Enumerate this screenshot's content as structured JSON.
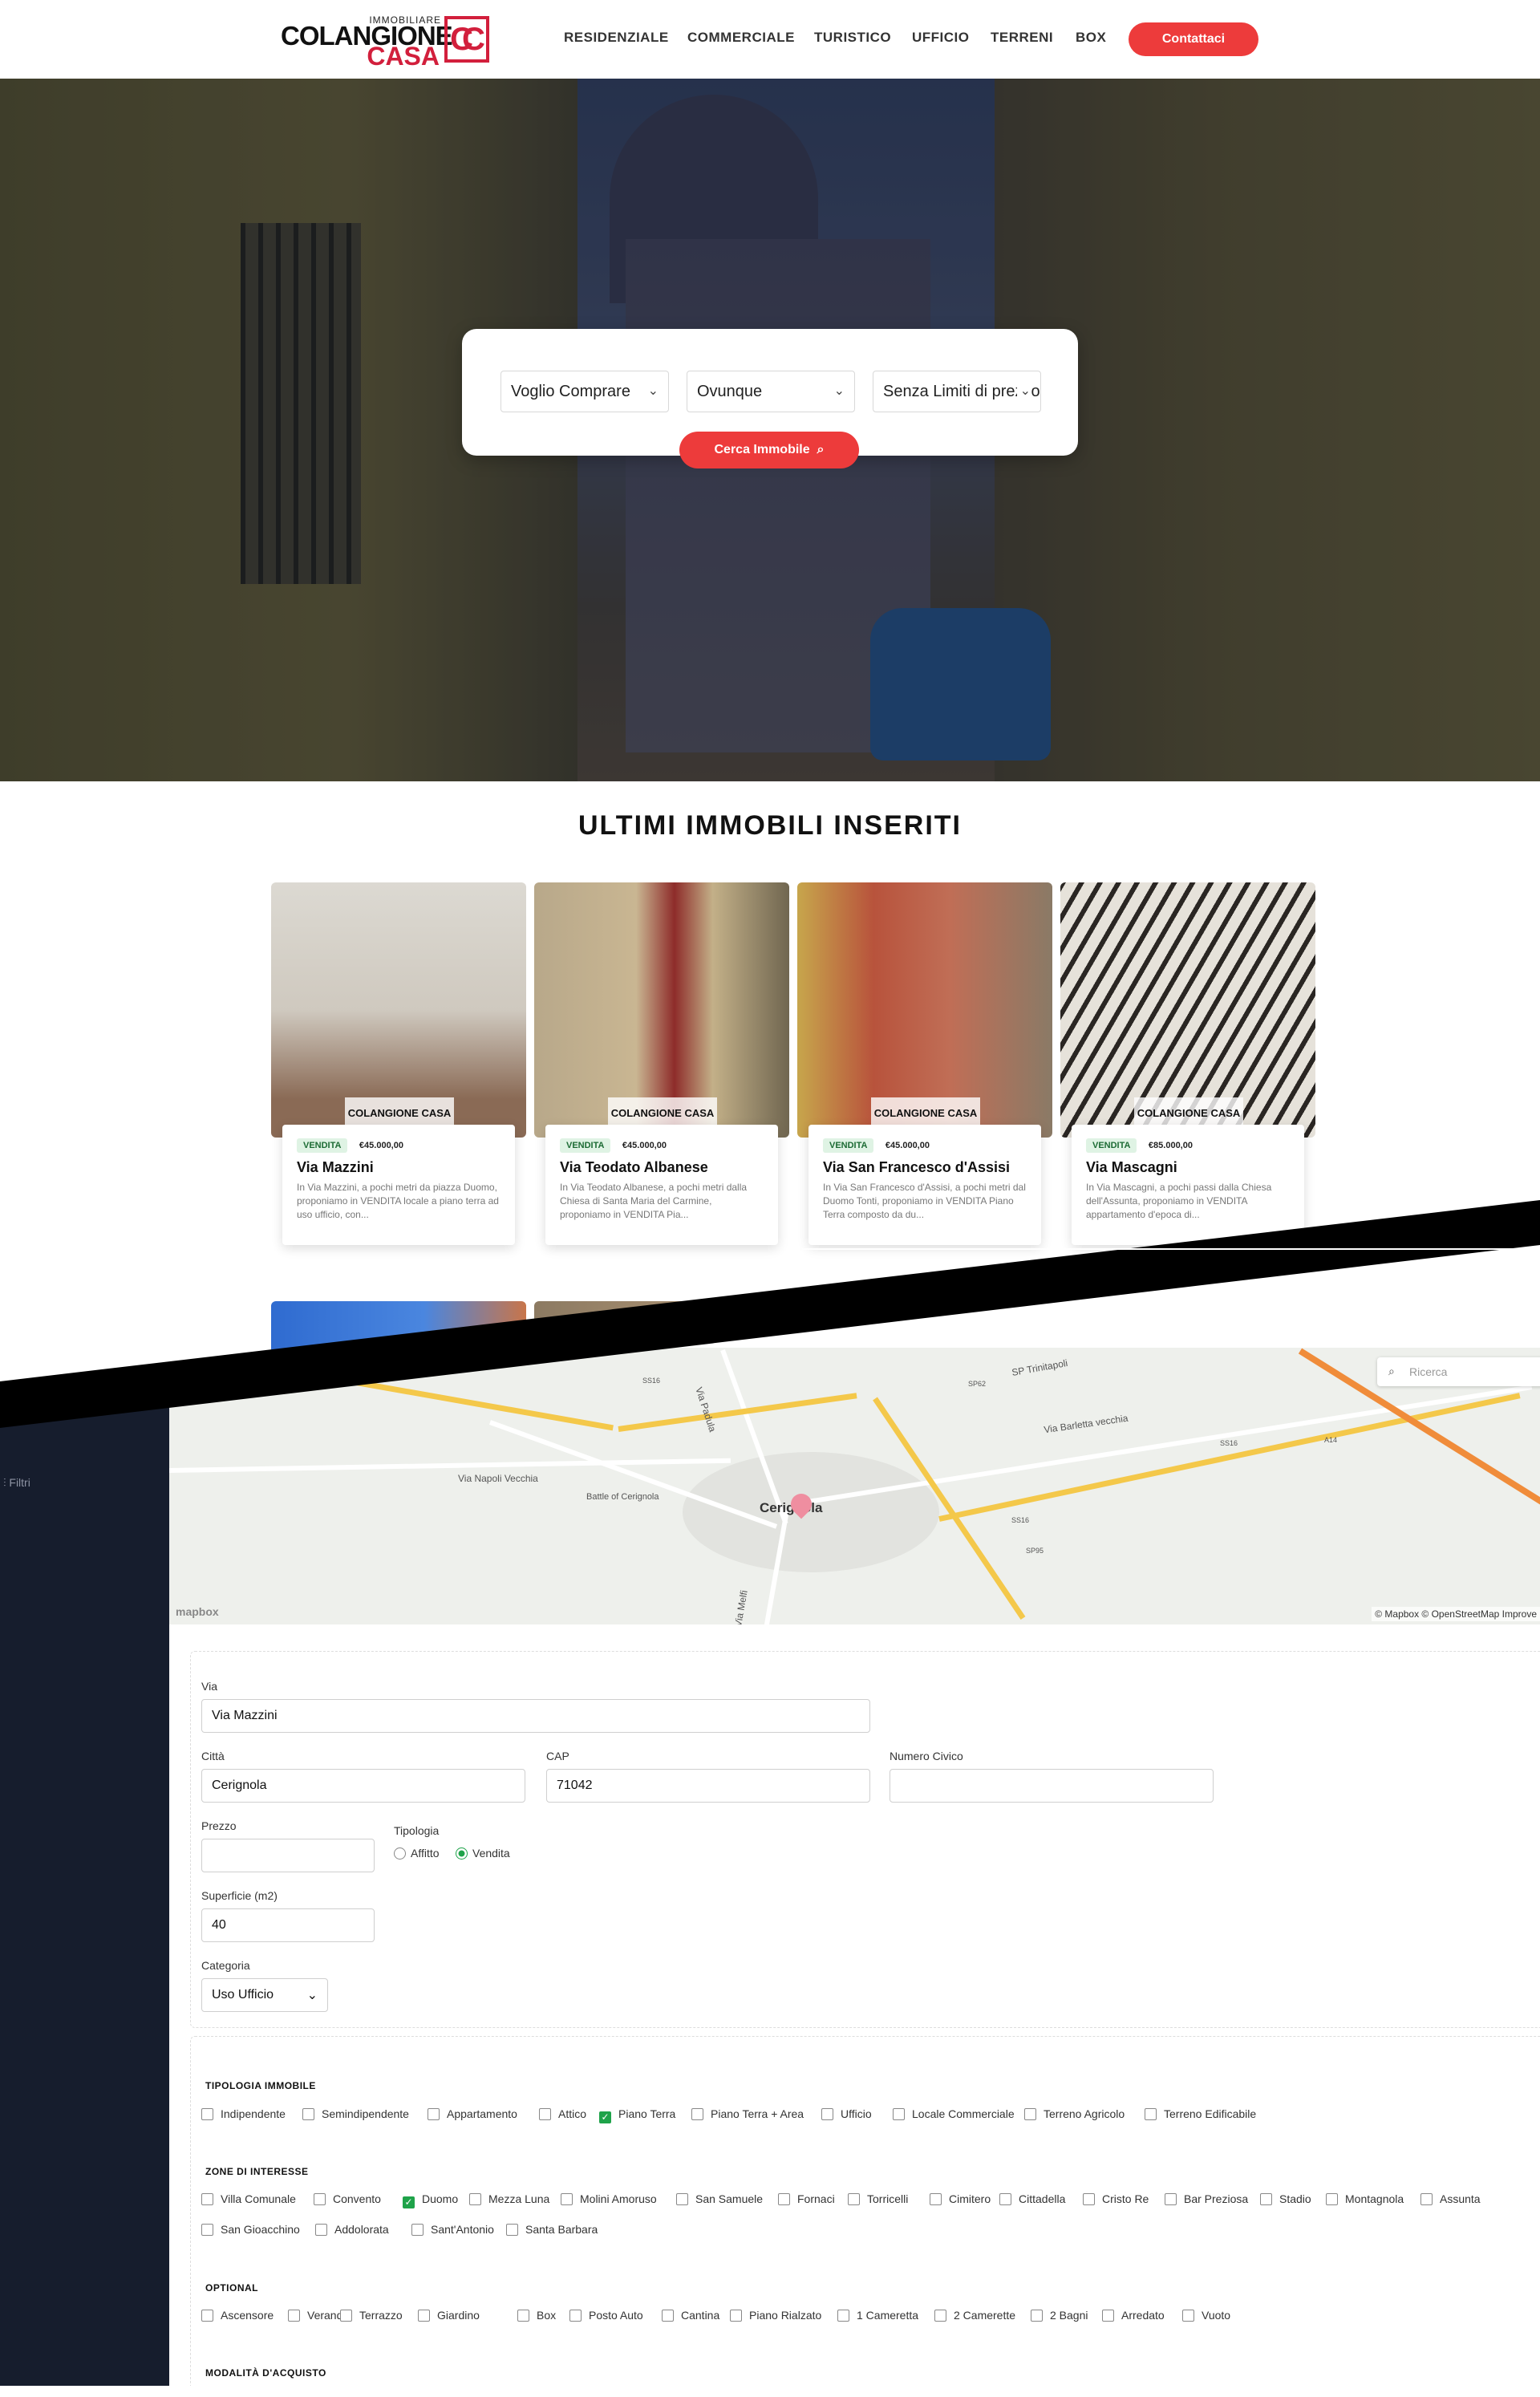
{
  "header": {
    "logo_top": "IMMOBILIARE",
    "logo_main": "COLANGIONE",
    "logo_sub": "CASA",
    "logo_mark": "CC",
    "nav": [
      "RESIDENZIALE",
      "COMMERCIALE",
      "TURISTICO",
      "UFFICIO",
      "TERRENI",
      "BOX"
    ],
    "cta": "Contattaci"
  },
  "search": {
    "selects": [
      "Voglio Comprare",
      "Ovunque",
      "Senza Limiti di prezzo"
    ],
    "button": "Cerca Immobile"
  },
  "listings": {
    "title": "ULTIMI IMMOBILI INSERITI",
    "watermark": "COLANGIONE CASA",
    "items": [
      {
        "badge": "VENDITA",
        "price": "€45.000,00",
        "title": "Via Mazzini",
        "desc": "In Via Mazzini, a pochi metri da piazza Duomo, proponiamo in VENDITA locale a piano terra ad uso ufficio, con..."
      },
      {
        "badge": "VENDITA",
        "price": "€45.000,00",
        "title": "Via Teodato Albanese",
        "desc": "In Via Teodato Albanese, a pochi metri dalla Chiesa di Santa Maria del Carmine, proponiamo in VENDITA Pia..."
      },
      {
        "badge": "VENDITA",
        "price": "€45.000,00",
        "title": "Via San Francesco d'Assisi",
        "desc": "In Via San Francesco d'Assisi, a pochi metri dal Duomo Tonti, proponiamo in VENDITA Piano Terra composto da du..."
      },
      {
        "badge": "VENDITA",
        "price": "€85.000,00",
        "title": "Via Mascagni",
        "desc": "In Via Mascagni, a pochi passi dalla Chiesa dell'Assunta, proponiamo in VENDITA appartamento d'epoca di..."
      }
    ]
  },
  "admin": {
    "sidebar": {
      "filter_label": "Filtri"
    },
    "map": {
      "search_placeholder": "Ricerca",
      "labels": [
        "SP Trinitapoli",
        "SS16",
        "SP62",
        "Via Padula",
        "Via Barletta vecchia",
        "SS16",
        "A14",
        "Via Napoli Vecchia",
        "Battle of Cerignola",
        "Cerignola",
        "SS16",
        "SP95",
        "Via Melfi"
      ],
      "logo": "mapbox",
      "attribution": "© Mapbox © OpenStreetMap Improve"
    },
    "form": {
      "via_label": "Via",
      "via_value": "Via Mazzini",
      "citta_label": "Città",
      "citta_value": "Cerignola",
      "cap_label": "CAP",
      "cap_value": "71042",
      "civico_label": "Numero Civico",
      "civico_value": "",
      "prezzo_label": "Prezzo",
      "prezzo_value": "",
      "tipologia_label": "Tipologia",
      "tipologia_options": [
        "Affitto",
        "Vendita"
      ],
      "tipologia_selected": "Vendita",
      "superficie_label": "Superficie (m2)",
      "superficie_value": "40",
      "categoria_label": "Categoria",
      "categoria_value": "Uso Ufficio"
    },
    "tipologia_immobile": {
      "title": "TIPOLOGIA IMMOBILE",
      "options": [
        "Indipendente",
        "Semindipendente",
        "Appartamento",
        "Attico",
        "Piano Terra",
        "Piano Terra + Area",
        "Ufficio",
        "Locale Commerciale",
        "Terreno Agricolo",
        "Terreno Edificabile"
      ],
      "checked": [
        "Piano Terra"
      ]
    },
    "zone": {
      "title": "ZONE DI INTERESSE",
      "options": [
        "Villa Comunale",
        "Convento",
        "Duomo",
        "Mezza Luna",
        "Molini Amoruso",
        "San Samuele",
        "Fornaci",
        "Torricelli",
        "Cimitero",
        "Cittadella",
        "Cristo Re",
        "Bar Preziosa",
        "Stadio",
        "Montagnola",
        "Assunta",
        "San Gioacchino",
        "Addolorata",
        "Sant'Antonio",
        "Santa Barbara"
      ],
      "checked": [
        "Duomo"
      ]
    },
    "optional": {
      "title": "OPTIONAL",
      "options": [
        "Ascensore",
        "Veranda",
        "Terrazzo",
        "Giardino",
        "Box",
        "Posto Auto",
        "Cantina",
        "Piano Rialzato",
        "1 Cameretta",
        "2 Camerette",
        "2 Bagni",
        "Arredato",
        "Vuoto"
      ],
      "checked": []
    },
    "modalita": {
      "title": "MODALITÀ D'ACQUISTO"
    }
  }
}
